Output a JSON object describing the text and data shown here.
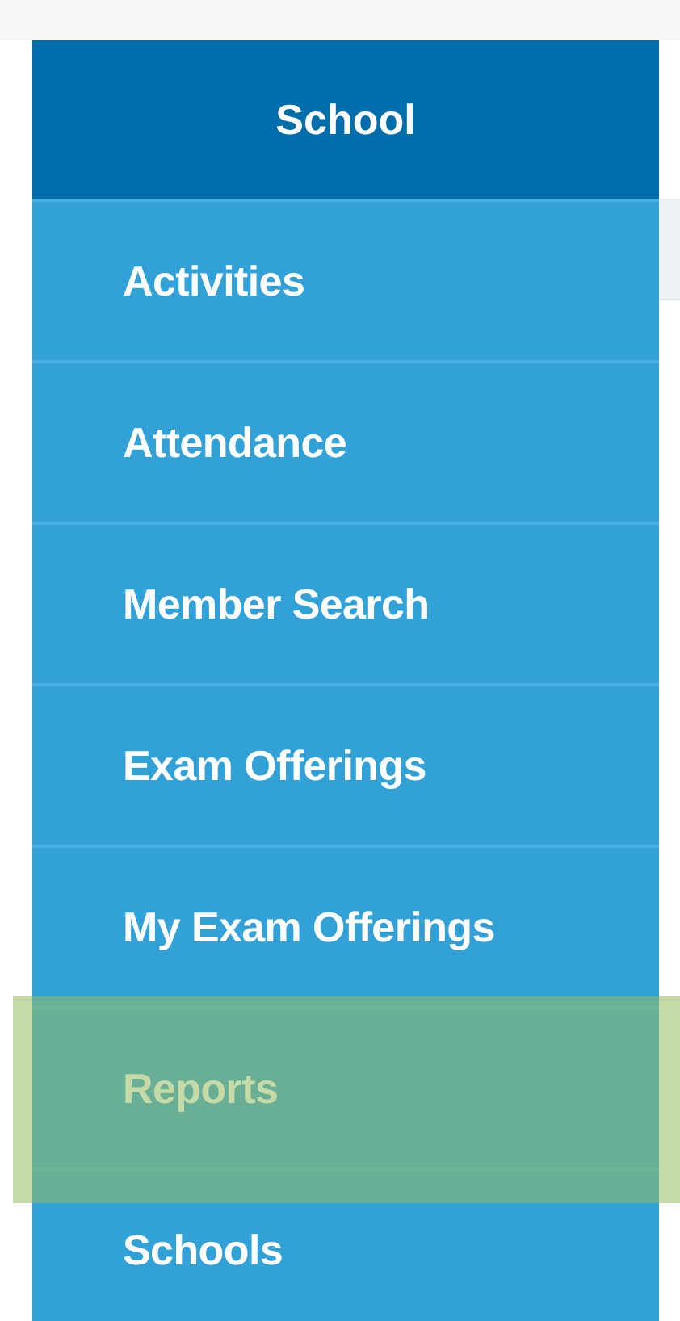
{
  "menu": {
    "title": "School",
    "items": [
      {
        "label": "Activities",
        "selected": false
      },
      {
        "label": "Attendance",
        "selected": false
      },
      {
        "label": "Member Search",
        "selected": false
      },
      {
        "label": "Exam Offerings",
        "selected": false
      },
      {
        "label": "My Exam Offerings",
        "selected": false
      },
      {
        "label": "Reports",
        "selected": true
      },
      {
        "label": "Schools",
        "selected": false
      }
    ]
  }
}
